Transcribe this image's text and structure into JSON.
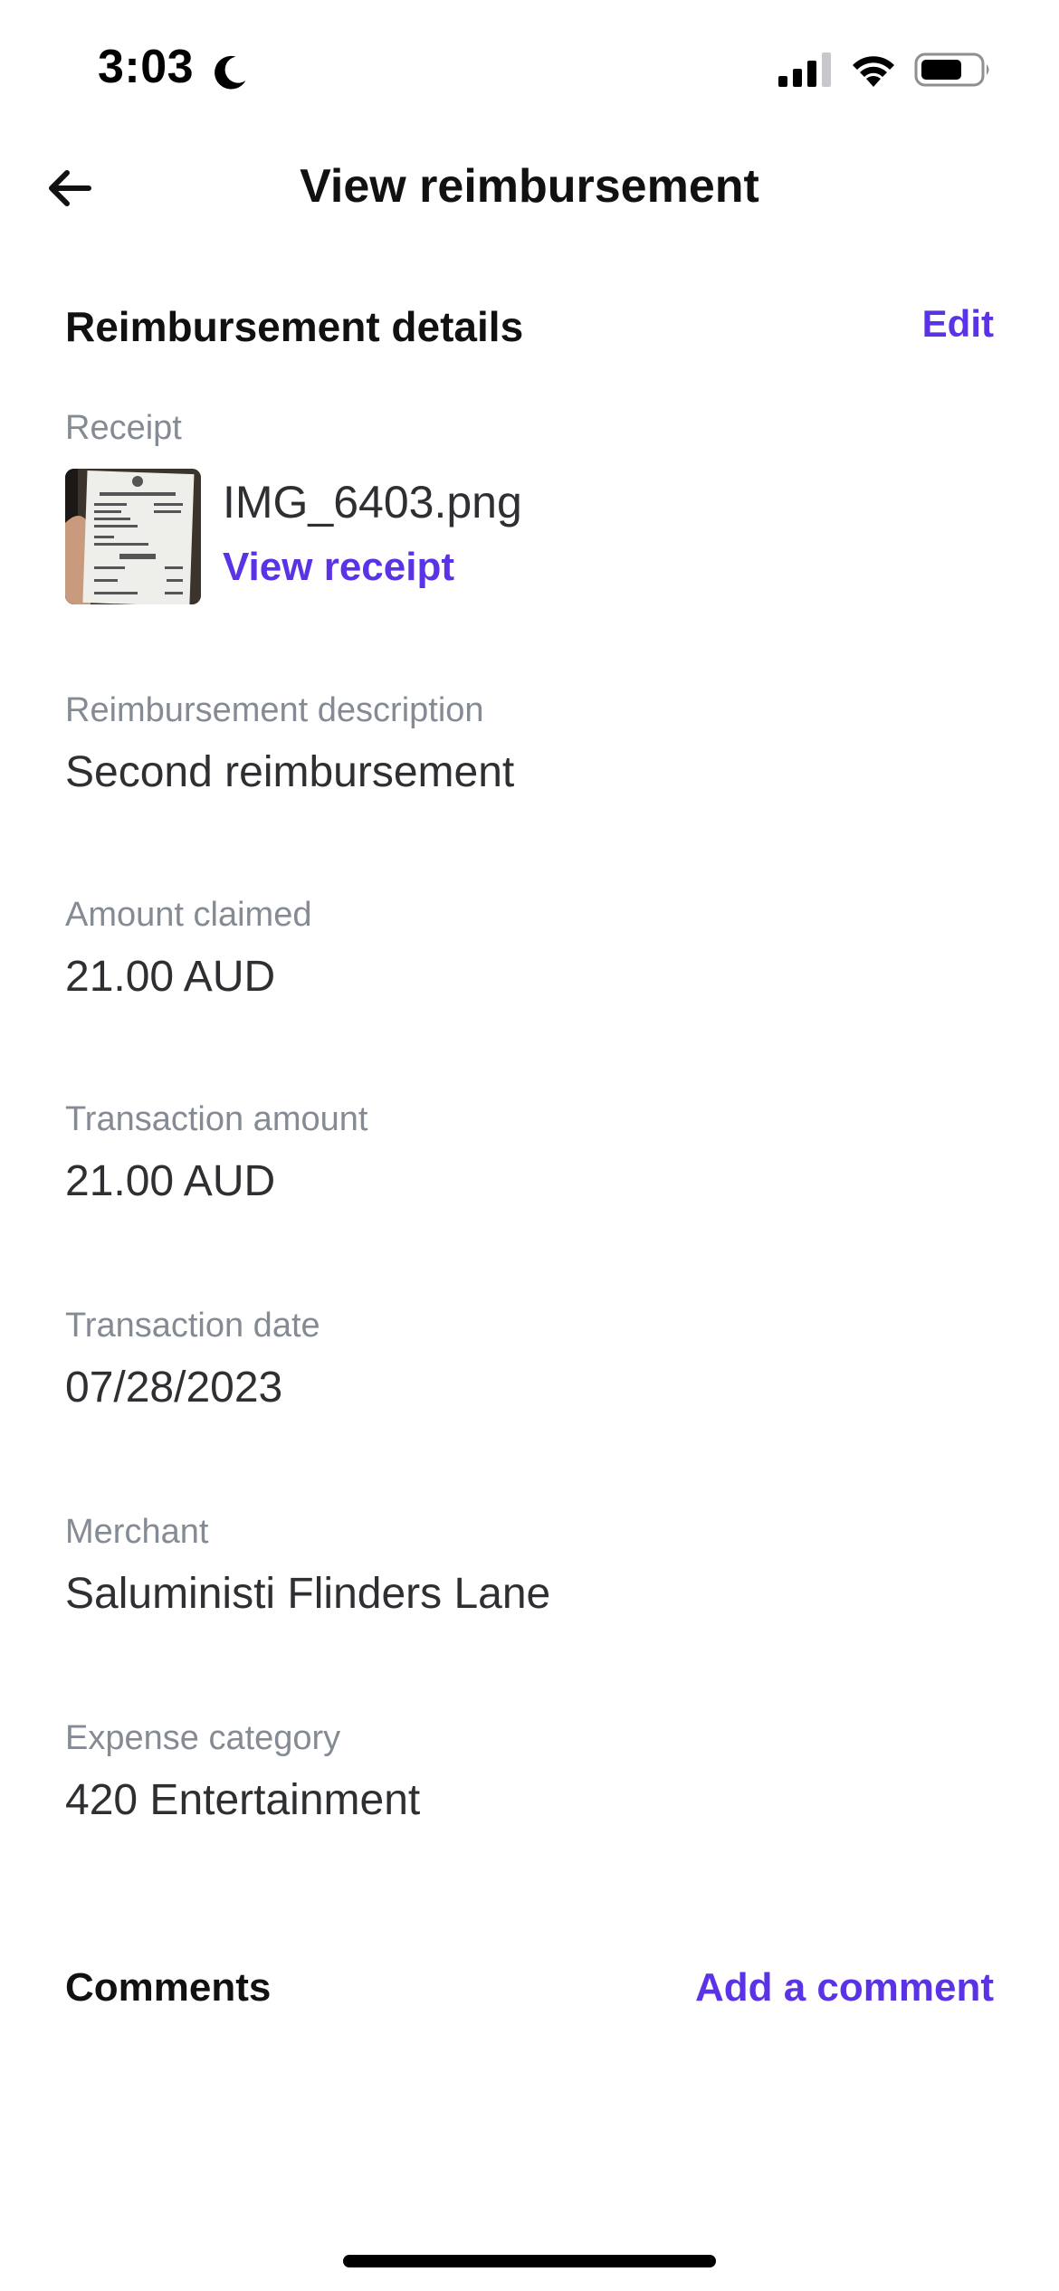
{
  "status_bar": {
    "time": "3:03"
  },
  "header": {
    "title": "View reimbursement"
  },
  "details": {
    "section_title": "Reimbursement details",
    "edit_label": "Edit"
  },
  "receipt": {
    "label": "Receipt",
    "file_name": "IMG_6403.png",
    "view_label": "View receipt"
  },
  "fields": {
    "description_label": "Reimbursement description",
    "description_value": "Second reimbursement",
    "amount_claimed_label": "Amount claimed",
    "amount_claimed_value": "21.00 AUD",
    "transaction_amount_label": "Transaction amount",
    "transaction_amount_value": "21.00 AUD",
    "transaction_date_label": "Transaction date",
    "transaction_date_value": "07/28/2023",
    "merchant_label": "Merchant",
    "merchant_value": "Saluministi Flinders Lane",
    "category_label": "Expense category",
    "category_value": "420 Entertainment"
  },
  "comments": {
    "title": "Comments",
    "add_label": "Add a comment"
  },
  "colors": {
    "accent": "#5b33e6",
    "label": "#858b94",
    "text": "#2f2f33"
  },
  "icons": [
    "moon-icon",
    "cellular-signal-icon",
    "wifi-icon",
    "battery-icon",
    "back-arrow-icon"
  ]
}
